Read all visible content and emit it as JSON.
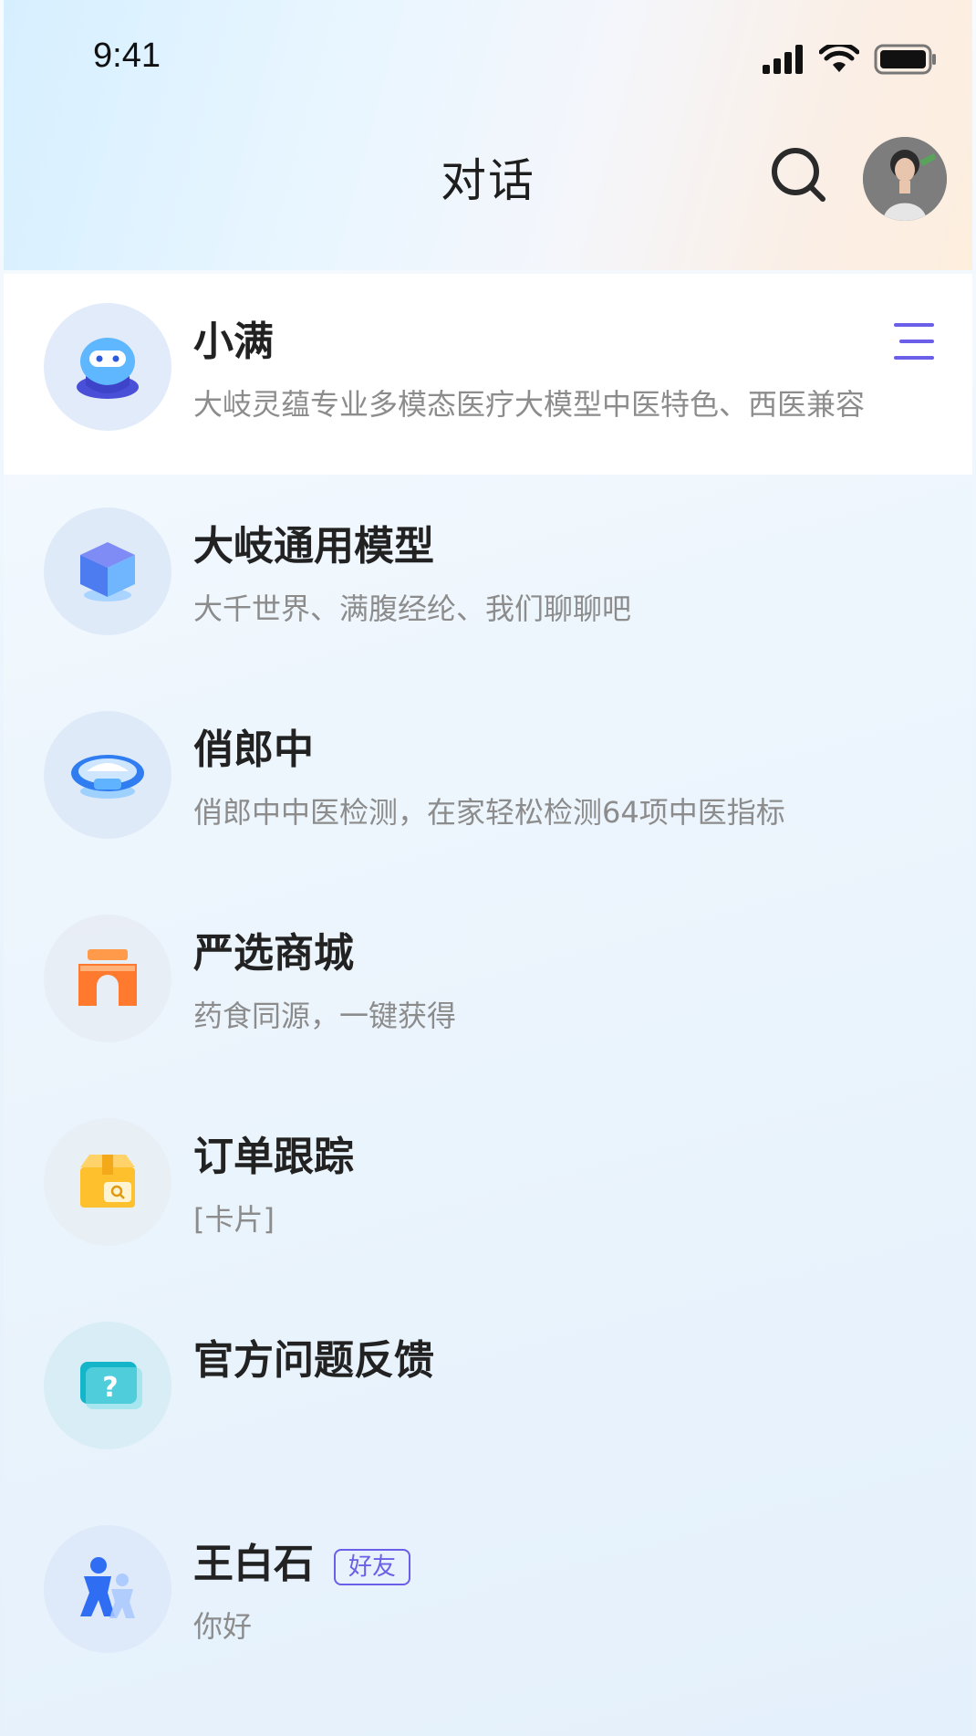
{
  "status": {
    "time": "9:41"
  },
  "header": {
    "title": "对话"
  },
  "conversations": [
    {
      "name": "小满",
      "subtitle": "大岐灵蕴专业多模态医疗大模型中医特色、西医兼容",
      "icon": "robot-icon",
      "pinned": true
    },
    {
      "name": "大岐通用模型",
      "subtitle": "大千世界、满腹经纶、我们聊聊吧",
      "icon": "cube-icon"
    },
    {
      "name": "俏郎中",
      "subtitle": "俏郎中中医检测，在家轻松检测64项中医指标",
      "icon": "ring-device-icon"
    },
    {
      "name": "严选商城",
      "subtitle": "药食同源，一键获得",
      "icon": "shop-icon"
    },
    {
      "name": "订单跟踪",
      "subtitle": "[卡片]",
      "icon": "package-icon"
    },
    {
      "name": "官方问题反馈",
      "subtitle": "",
      "icon": "question-monitor-icon"
    },
    {
      "name": "王白石",
      "subtitle": "你好",
      "badge": "好友",
      "icon": "friend-avatar-icon"
    }
  ],
  "colors": {
    "accent": "#6b5ee8",
    "menu": "#6b5ee8"
  }
}
